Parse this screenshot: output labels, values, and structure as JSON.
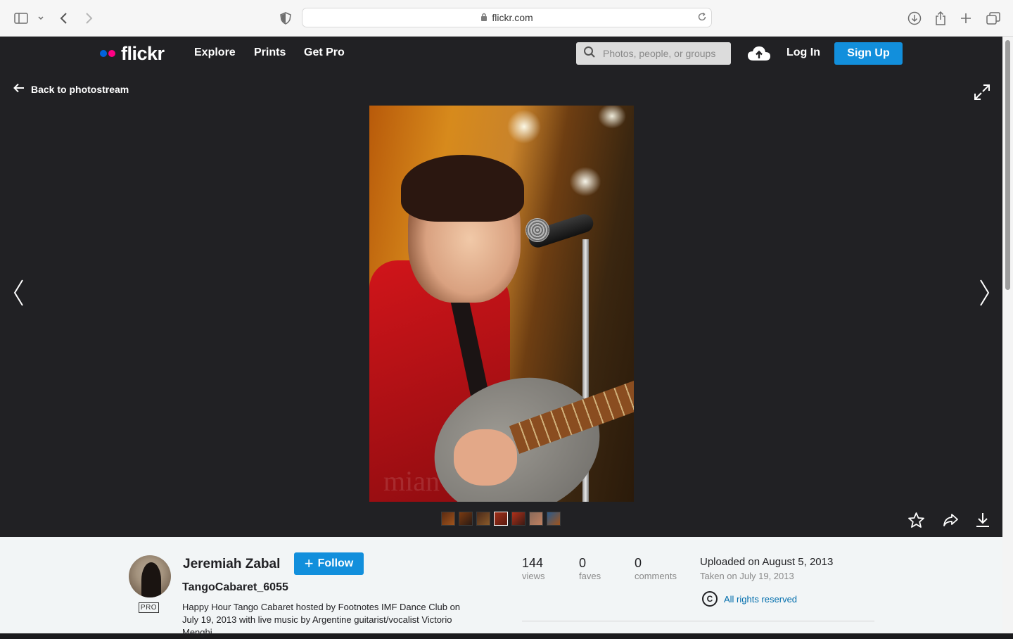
{
  "browser": {
    "url": "flickr.com",
    "icons": [
      "sidebar-icon",
      "chevron-down-icon",
      "back-icon",
      "forward-icon",
      "shield-icon",
      "lock-icon",
      "reload-icon",
      "download-icon",
      "share-icon",
      "new-tab-icon",
      "tabs-icon"
    ]
  },
  "nav": {
    "logo": "flickr",
    "logo_colors": [
      "#0063dc",
      "#ff0084"
    ],
    "links": [
      "Explore",
      "Prints",
      "Get Pro"
    ],
    "search_placeholder": "Photos, people, or groups",
    "login": "Log In",
    "signup": "Sign Up"
  },
  "viewer": {
    "back_label": "Back to photostream",
    "photo_watermark": "mian",
    "thumb_count": 7,
    "active_thumb": 4
  },
  "meta": {
    "owner": "Jeremiah Zabal",
    "pro": "PRO",
    "follow": "Follow",
    "title": "TangoCabaret_6055",
    "description": "Happy Hour Tango Cabaret hosted by Footnotes IMF Dance Club on July 19, 2013 with live music by Argentine guitarist/vocalist Victorio Menghi",
    "stats": [
      {
        "value": "144",
        "label": "views"
      },
      {
        "value": "0",
        "label": "faves"
      },
      {
        "value": "0",
        "label": "comments"
      }
    ],
    "uploaded": "Uploaded on August 5, 2013",
    "taken": "Taken on July 19, 2013",
    "license_symbol": "C",
    "license": "All rights reserved"
  },
  "colors": {
    "accent": "#128fdc",
    "nav_bg": "#212124",
    "panel_bg": "#f2f5f6",
    "link": "#006dac"
  }
}
